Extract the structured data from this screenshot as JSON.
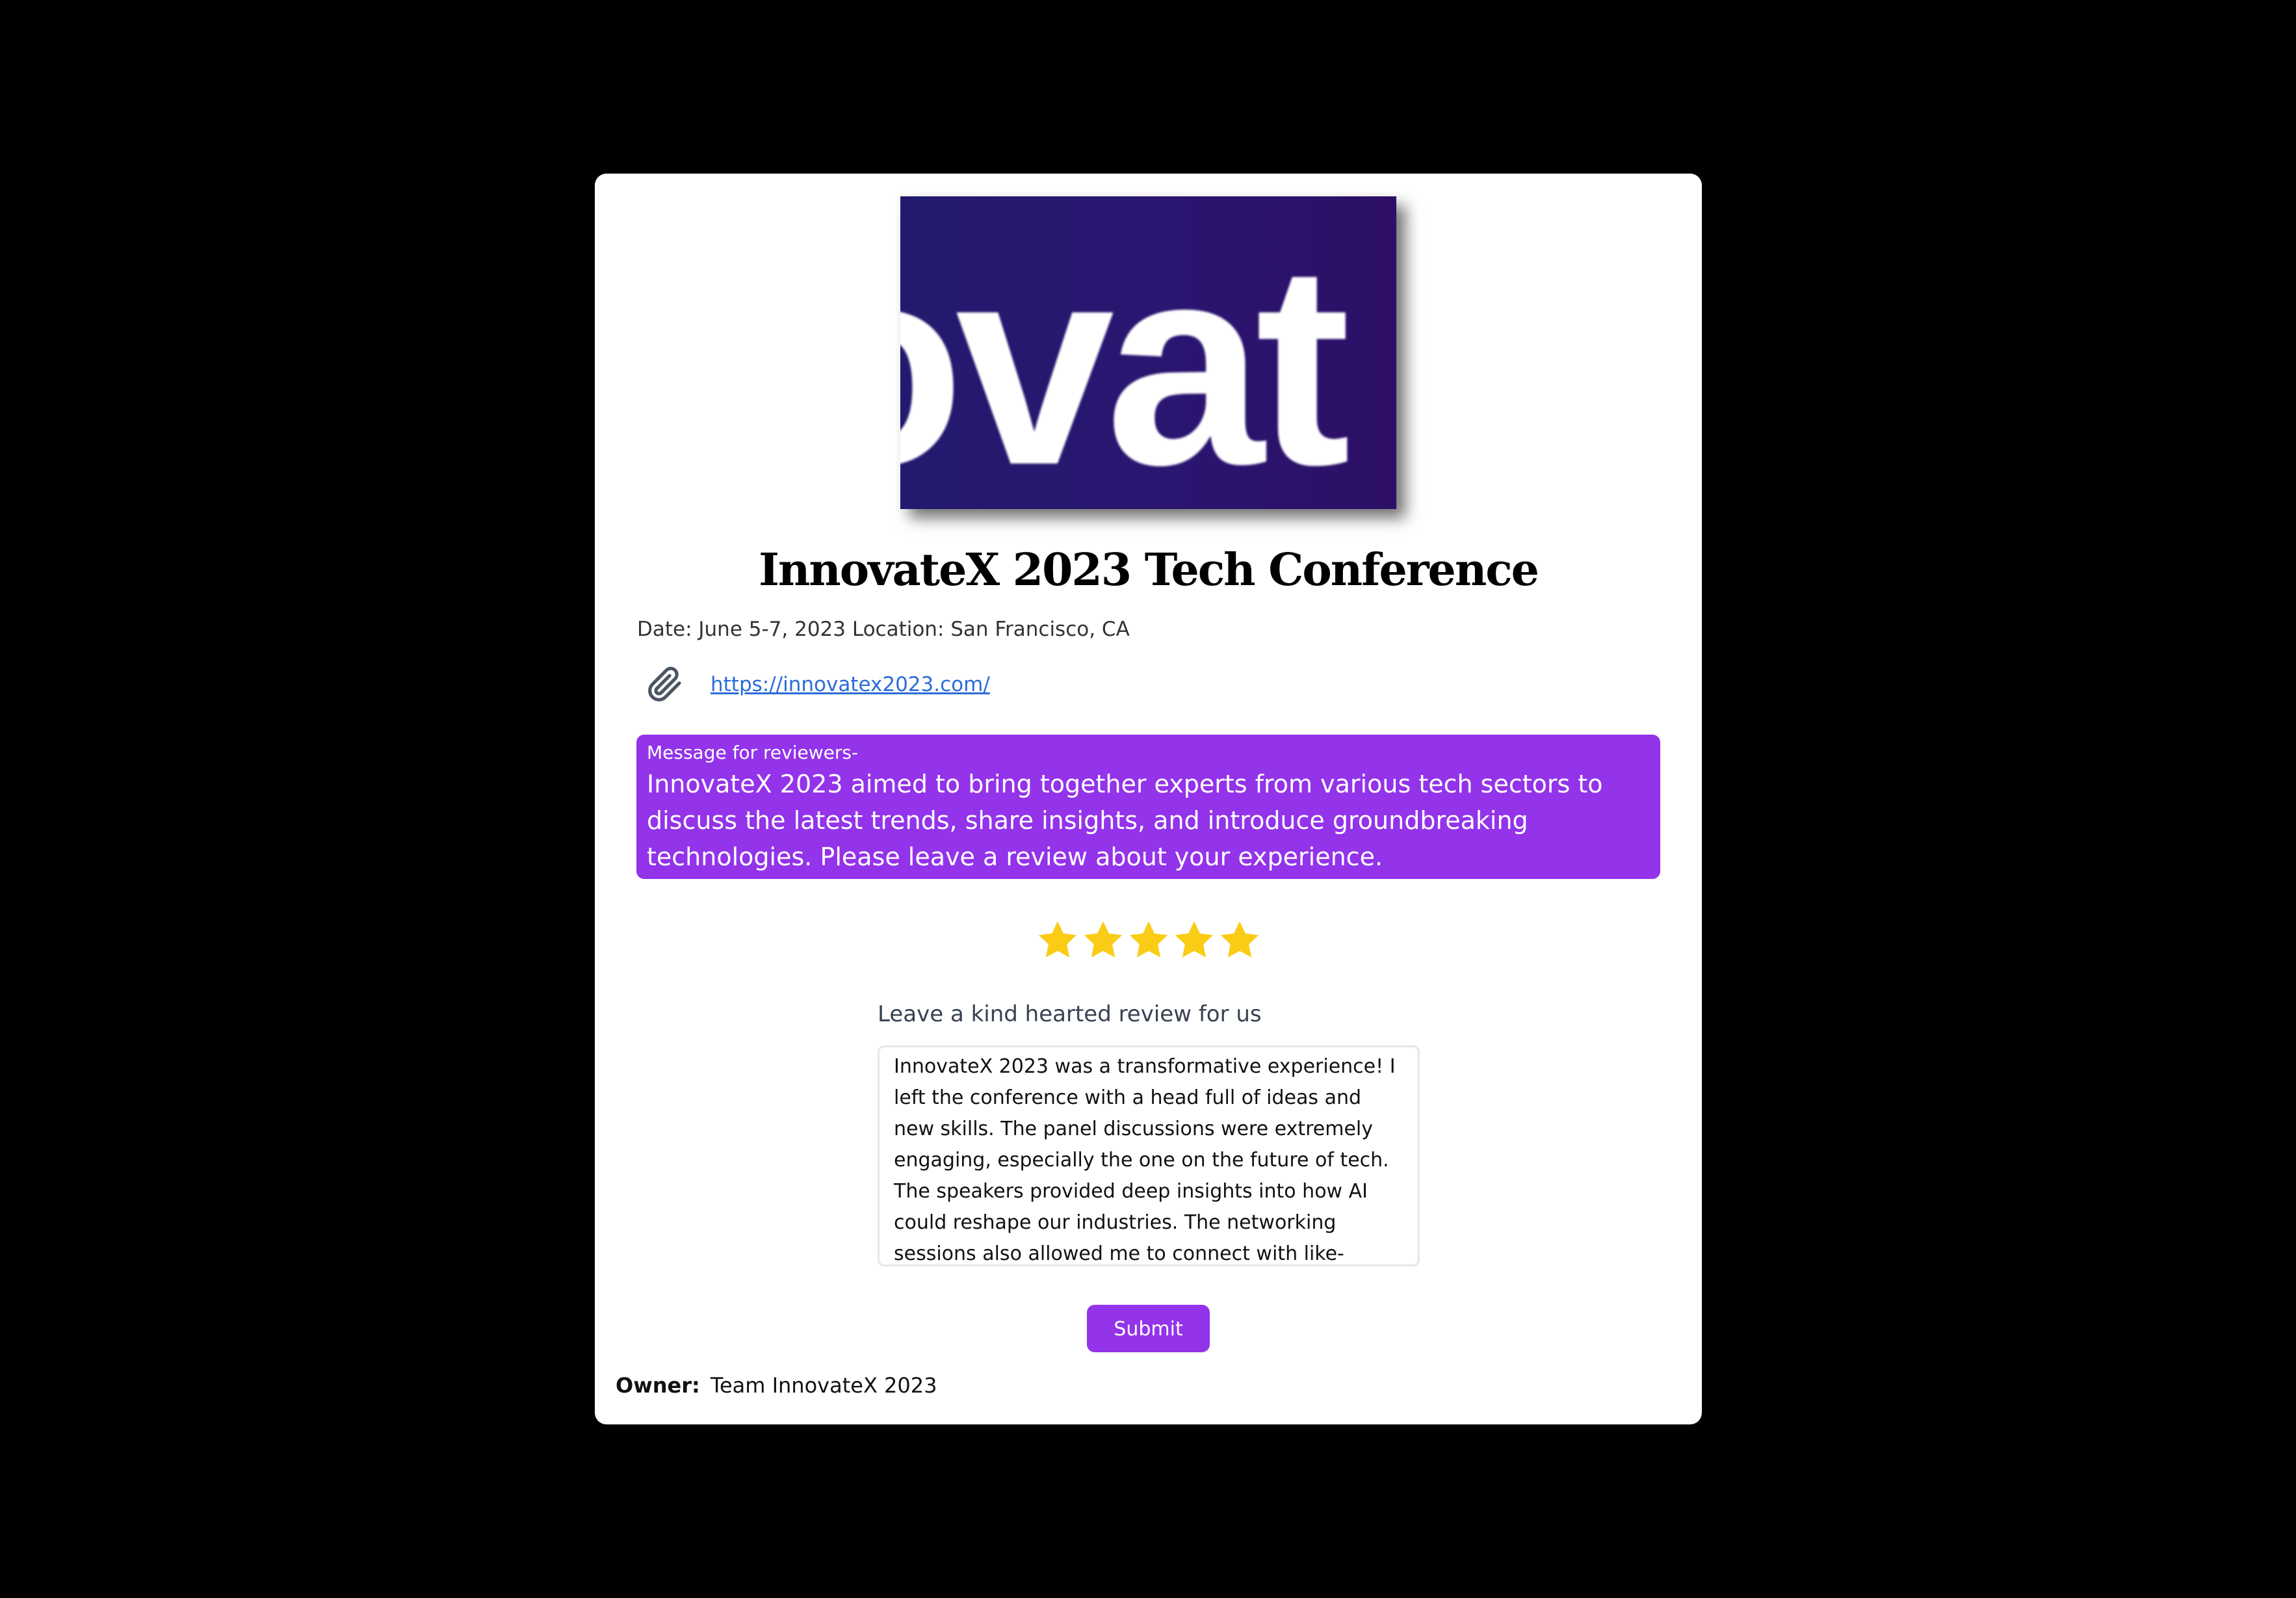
{
  "banner": {
    "text": "ovat"
  },
  "event": {
    "title": "InnovateX 2023 Tech Conference",
    "meta": "Date: June 5-7, 2023 Location: San Francisco, CA",
    "link_text": "https://innovatex2023.com/",
    "link_href": "https://innovatex2023.com/"
  },
  "message": {
    "label": "Message for reviewers-",
    "body": "InnovateX 2023 aimed to bring together experts from various tech sectors to discuss the latest trends, share insights, and introduce groundbreaking technologies. Please leave a review about your experience."
  },
  "rating": {
    "value": 5,
    "max": 5,
    "star_color": "#facc15"
  },
  "review": {
    "label": "Leave a kind hearted review for us",
    "value": "InnovateX 2023 was a transformative experience! I left the conference with a head full of ideas and new skills. The panel discussions were extremely engaging, especially the one on the future of tech. The speakers provided deep insights into how AI could reshape our industries. The networking sessions also allowed me to connect with like-"
  },
  "submit": {
    "label": "Submit"
  },
  "owner": {
    "label": "Owner:",
    "value": "Team InnovateX 2023"
  },
  "colors": {
    "accent": "#9333ea",
    "link": "#2b6cd8",
    "background": "#000000"
  },
  "icons": {
    "attachment": "paperclip-icon",
    "star": "star-icon"
  }
}
